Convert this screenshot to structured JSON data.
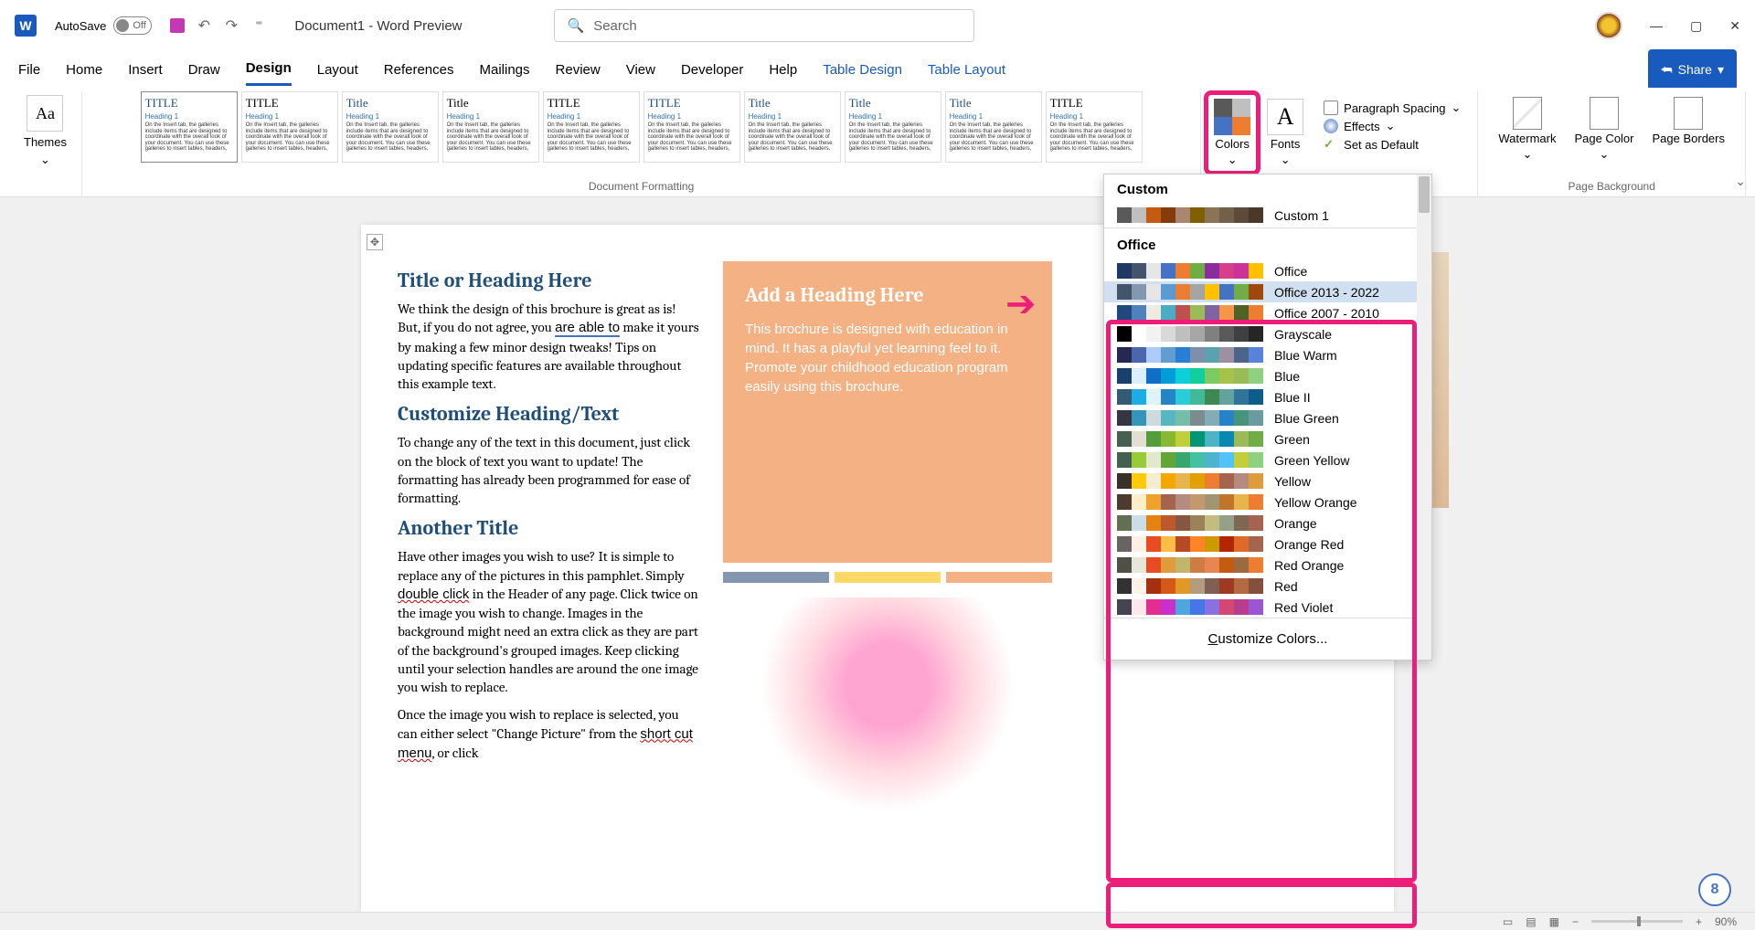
{
  "titlebar": {
    "autosave_label": "AutoSave",
    "autosave_state": "Off",
    "doc_title": "Document1  -  Word Preview",
    "search_placeholder": "Search"
  },
  "tabs": {
    "file": "File",
    "home": "Home",
    "insert": "Insert",
    "draw": "Draw",
    "design": "Design",
    "layout": "Layout",
    "references": "References",
    "mailings": "Mailings",
    "review": "Review",
    "view": "View",
    "developer": "Developer",
    "help": "Help",
    "table_design": "Table Design",
    "table_layout": "Table Layout",
    "share": "Share"
  },
  "ribbon": {
    "themes": "Themes",
    "doc_formatting": "Document Formatting",
    "colors": "Colors",
    "fonts": "Fonts",
    "para_spacing": "Paragraph Spacing",
    "effects": "Effects",
    "set_default": "Set as Default",
    "watermark": "Watermark",
    "page_color": "Page Color",
    "page_borders": "Page Borders",
    "page_background": "Page Background"
  },
  "gallery_titles": [
    "TITLE",
    "TITLE",
    "Title",
    "Title",
    "TITLE",
    "TITLE",
    "Title",
    "Title",
    "Title",
    "TITLE"
  ],
  "doc": {
    "h1": "Title or Heading Here",
    "p1": "We think the design of this brochure is great as is!  But, if you do not agree, you are able to make it yours by making a few minor design tweaks!  Tips on updating specific features are available throughout this example text.",
    "h2": "Customize Heading/Text",
    "p2": "To change any of the text in this document, just click on the block of text you want to update!  The formatting has already been programmed for ease of formatting.",
    "h3": "Another Title",
    "p3": "Have other images you wish to use?  It is simple to replace any of the pictures in this pamphlet.  Simply double click in the Header of any page.  Click twice on the image you wish to change.  Images in the background might need an extra click as they are part of the background's grouped images.  Keep clicking until your selection handles are around the one image you wish to replace.",
    "p4": "Once the image you wish to replace is selected, you can either select \"Change Picture\" from the short cut menu, or click",
    "peach_h": "Add a Heading Here",
    "peach_p": "This brochure is designed with education in mind.  It has a playful yet learning feel to it.  Promote your childhood education program easily using this brochure."
  },
  "colors_menu": {
    "custom_header": "Custom",
    "custom1": "Custom 1",
    "office_header": "Office",
    "customize": "Customize Colors...",
    "themes": [
      {
        "name": "Office",
        "c": [
          "#1f3864",
          "#44546a",
          "#e7e6e6",
          "#4472c4",
          "#ed7d31",
          "#70ad47",
          "#8b2e9b",
          "#d73f8c",
          "#cc3399",
          "#ffc000"
        ]
      },
      {
        "name": "Office 2013 - 2022",
        "c": [
          "#44546a",
          "#8497b0",
          "#e7e6e6",
          "#5b9bd5",
          "#ed7d31",
          "#a5a5a5",
          "#ffc000",
          "#4472c4",
          "#70ad47",
          "#9e480e"
        ]
      },
      {
        "name": "Office 2007 - 2010",
        "c": [
          "#1f497d",
          "#4f81bd",
          "#eeece1",
          "#4bacc6",
          "#c0504d",
          "#9bbb59",
          "#8064a2",
          "#f79646",
          "#4f6228",
          "#ed7d31"
        ]
      },
      {
        "name": "Grayscale",
        "c": [
          "#000000",
          "#ffffff",
          "#f2f2f2",
          "#d9d9d9",
          "#bfbfbf",
          "#a6a6a6",
          "#808080",
          "#595959",
          "#404040",
          "#262626"
        ]
      },
      {
        "name": "Blue Warm",
        "c": [
          "#242852",
          "#4a66ac",
          "#accbf9",
          "#629dd1",
          "#297fd5",
          "#7f8fa9",
          "#5aa2ae",
          "#9d90a0",
          "#4c6489",
          "#5982db"
        ]
      },
      {
        "name": "Blue",
        "c": [
          "#17406d",
          "#dbefff",
          "#0f6fc6",
          "#009dd9",
          "#0bd0d9",
          "#10cf9b",
          "#7cca62",
          "#a5c249",
          "#9bbb59",
          "#8fd180"
        ]
      },
      {
        "name": "Blue II",
        "c": [
          "#335b74",
          "#1cade4",
          "#dff3fa",
          "#2683c6",
          "#27ced7",
          "#42ba97",
          "#3e8853",
          "#62a39f",
          "#2e7599",
          "#0e5c8a"
        ]
      },
      {
        "name": "Blue Green",
        "c": [
          "#373545",
          "#3494ba",
          "#cedbde",
          "#58b6c0",
          "#75bda7",
          "#7a8c8e",
          "#84acb6",
          "#2683c6",
          "#46947b",
          "#6b9b9e"
        ]
      },
      {
        "name": "Green",
        "c": [
          "#455f51",
          "#e3ded1",
          "#549e39",
          "#8ab833",
          "#c0cf3a",
          "#029676",
          "#4ab5c4",
          "#0989b1",
          "#9bbb59",
          "#70ad47"
        ]
      },
      {
        "name": "Green Yellow",
        "c": [
          "#455f51",
          "#99cb38",
          "#e2e8c9",
          "#63a537",
          "#37a76f",
          "#44c1a3",
          "#4eb3cf",
          "#51c3f9",
          "#c0cf3a",
          "#8fd180"
        ]
      },
      {
        "name": "Yellow",
        "c": [
          "#39302a",
          "#ffca08",
          "#f5edcf",
          "#f5a700",
          "#e8b54d",
          "#e2a100",
          "#ed7d31",
          "#a5644e",
          "#b58b80",
          "#e09b3c"
        ]
      },
      {
        "name": "Yellow Orange",
        "c": [
          "#4e3b30",
          "#fbeec9",
          "#f0a22e",
          "#a5644e",
          "#b58b80",
          "#c3986d",
          "#a19574",
          "#c17529",
          "#e8b54d",
          "#ed7d31"
        ]
      },
      {
        "name": "Orange",
        "c": [
          "#637052",
          "#ccddea",
          "#e48312",
          "#bd582c",
          "#865640",
          "#9b8357",
          "#c2bc80",
          "#94a088",
          "#7e6753",
          "#a5644e"
        ]
      },
      {
        "name": "Orange Red",
        "c": [
          "#696464",
          "#fff0e6",
          "#e84c22",
          "#ffbd47",
          "#b64926",
          "#ff8427",
          "#cc9900",
          "#b22600",
          "#df6a29",
          "#a5644e"
        ]
      },
      {
        "name": "Red Orange",
        "c": [
          "#505046",
          "#eae5d9",
          "#e84c22",
          "#e09b3c",
          "#c1b56b",
          "#ce7b44",
          "#e88651",
          "#c55a11",
          "#9b6a3e",
          "#ed7d31"
        ]
      },
      {
        "name": "Red",
        "c": [
          "#323232",
          "#fef2e8",
          "#a5300f",
          "#d55816",
          "#e19825",
          "#b19c7d",
          "#7f5f52",
          "#9e3a21",
          "#b26b40",
          "#844f3d"
        ]
      },
      {
        "name": "Red Violet",
        "c": [
          "#454551",
          "#fde8ec",
          "#e32d91",
          "#c830cc",
          "#4ea6dc",
          "#4775e7",
          "#8971e1",
          "#d54773",
          "#b83d8f",
          "#9b57d3"
        ]
      }
    ]
  },
  "status": {
    "zoom": "90%"
  },
  "badge": "8"
}
